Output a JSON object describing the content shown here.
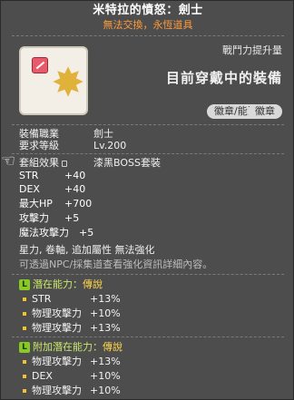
{
  "header": {
    "title": "米特拉的憤怒：劍士",
    "subtitle": "無法交換，永恆道具"
  },
  "icon": {
    "name": "emblem-icon",
    "badge": "sword-badge-icon"
  },
  "status": {
    "power_up": "戰鬥力提升量",
    "equip_label": "目前穿戴中的裝備"
  },
  "pills": [
    "徽章/能源",
    "徽章"
  ],
  "info": {
    "job_key": "裝備職業",
    "job_val": "劍士",
    "level_key": "要求等級",
    "level_val": "Lv.200",
    "set_key": "套組效果",
    "set_val": "漆黑BOSS套裝"
  },
  "stats": [
    {
      "k": "STR",
      "v": "+40"
    },
    {
      "k": "DEX",
      "v": "+40"
    },
    {
      "k": "最大HP",
      "v": "+700"
    },
    {
      "k": "攻擊力",
      "v": "+5"
    },
    {
      "k": "魔法攻擊力",
      "v": "+5"
    }
  ],
  "notes": {
    "line1": "星力, 卷軸, 追加屬性 無法強化",
    "line2": "可透過NPC/採集道查看強化資訊詳細內容。"
  },
  "potential": {
    "badge": "L",
    "title": "潛在能力",
    "colon": "：",
    "rank": "傳說",
    "lines": [
      {
        "k": "STR",
        "v": "+13%"
      },
      {
        "k": "物理攻擊力",
        "v": "+10%"
      },
      {
        "k": "物理攻擊力",
        "v": "+13%"
      }
    ]
  },
  "additional": {
    "badge": "L",
    "title": "附加潛在能力",
    "colon": "：",
    "rank": "傳說",
    "lines": [
      {
        "k": "物理攻擊力",
        "v": "+13%"
      },
      {
        "k": "DEX",
        "v": "+10%"
      },
      {
        "k": "物理攻擊力",
        "v": "+10%"
      }
    ]
  },
  "colors": {
    "subtitle": "#ff9a3c",
    "legendary": "#c9e86a",
    "rank": "#ffd94a",
    "bullet": "#f2c12e"
  }
}
